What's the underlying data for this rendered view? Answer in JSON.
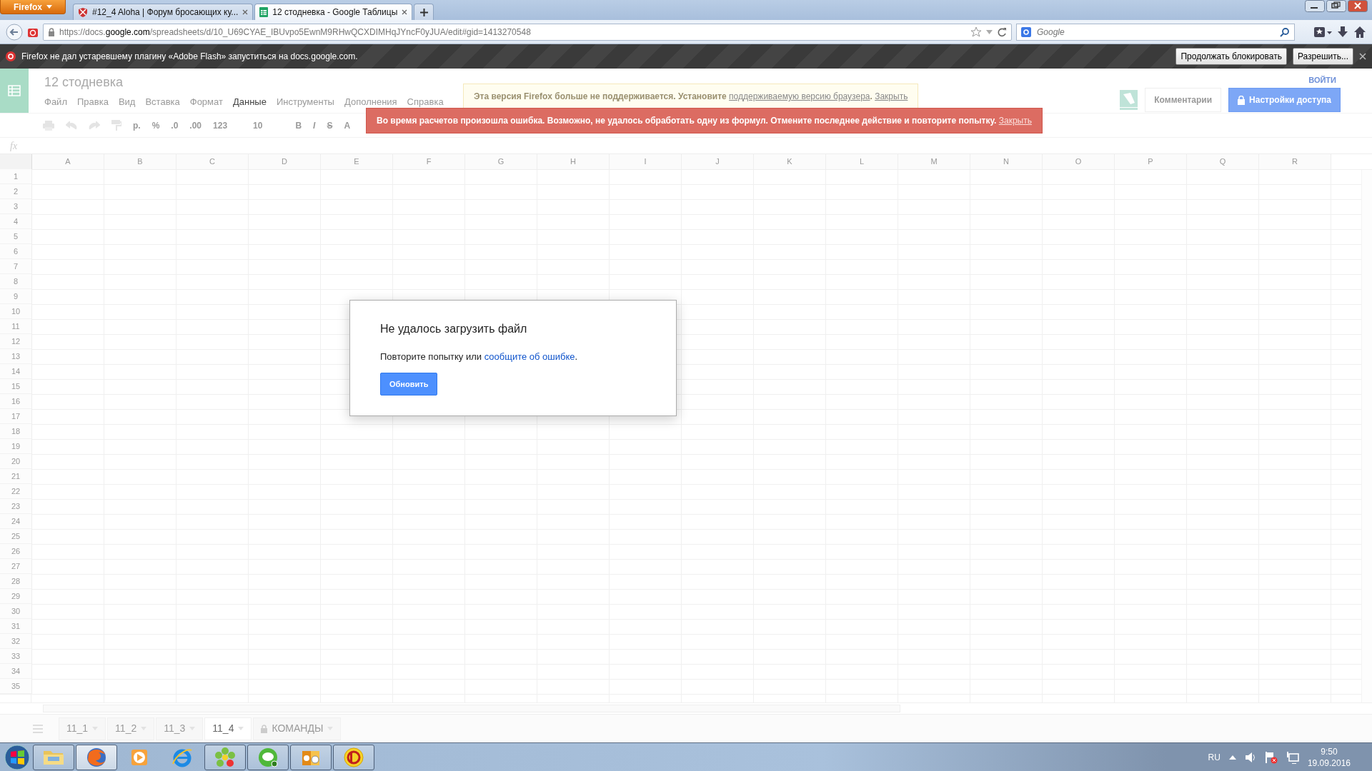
{
  "browser": {
    "menu_button": "Firefox",
    "tabs": [
      {
        "title": "#12_4 Aloha | Форум бросающих ку...",
        "selected": false,
        "kind": "forum"
      },
      {
        "title": "12 стодневка - Google Таблицы",
        "selected": true,
        "kind": "sheets"
      }
    ],
    "url": {
      "prefix": "https://docs.",
      "domain": "google.com",
      "path": "/spreadsheets/d/10_U69CYAE_IBUvpo5EwnM9RHwQCXDIMHqJYncF0yJUA/edit#gid=1413270548"
    },
    "search": {
      "placeholder": "Google"
    },
    "notification": {
      "text": "Firefox не дал устаревшему плагину «Adobe Flash» запуститься на docs.google.com.",
      "buttons": [
        "Продолжать блокировать",
        "Разрешить..."
      ]
    }
  },
  "sheet": {
    "title": "12 стодневка",
    "signin": "ВОЙТИ",
    "comments_button": "Комментарии",
    "share_button": "Настройки доступа",
    "menu": [
      {
        "label": "Файл",
        "highlighted": false
      },
      {
        "label": "Правка",
        "highlighted": false
      },
      {
        "label": "Вид",
        "highlighted": false
      },
      {
        "label": "Вставка",
        "highlighted": false
      },
      {
        "label": "Формат",
        "highlighted": false
      },
      {
        "label": "Данные",
        "highlighted": true
      },
      {
        "label": "Инструменты",
        "highlighted": false
      },
      {
        "label": "Дополнения",
        "highlighted": false
      },
      {
        "label": "Справка",
        "highlighted": false
      }
    ],
    "toolbar": {
      "currency": "р.",
      "percent": "%",
      "decrease_decimals": ".0",
      "increase_decimals": ".00",
      "format": "123",
      "font_size": "10",
      "bold": "B",
      "italic": "I",
      "strike": "S",
      "text_color": "A"
    },
    "formula_label": "fx",
    "warning": {
      "text": "Эта версия Firefox больше не поддерживается. Установите",
      "link": "поддерживаемую версию браузера",
      "after_link": ".",
      "close": "Закрыть"
    },
    "error": {
      "text": "Во время расчетов произошла ошибка. Возможно, не удалось обработать одну из формул. Отмените последнее действие и повторите попытку.",
      "close": "Закрыть"
    },
    "columns": [
      "A",
      "B",
      "C",
      "D",
      "E",
      "F",
      "G",
      "H",
      "I",
      "J",
      "K",
      "L",
      "M",
      "N",
      "O",
      "P",
      "Q",
      "R"
    ],
    "rows": [
      "1",
      "2",
      "3",
      "4",
      "5",
      "6",
      "7",
      "8",
      "9",
      "10",
      "11",
      "12",
      "13",
      "14",
      "15",
      "16",
      "17",
      "18",
      "19",
      "20",
      "21",
      "22",
      "23",
      "24",
      "25",
      "26",
      "27",
      "28",
      "29",
      "30",
      "31",
      "32",
      "33",
      "34",
      "35"
    ],
    "sheet_tabs": [
      {
        "label": "11_1",
        "selected": false,
        "locked": false
      },
      {
        "label": "11_2",
        "selected": false,
        "locked": false
      },
      {
        "label": "11_3",
        "selected": false,
        "locked": false
      },
      {
        "label": "11_4",
        "selected": true,
        "locked": false
      },
      {
        "label": "КОМАНДЫ",
        "selected": false,
        "locked": true
      }
    ]
  },
  "dialog": {
    "title": "Не удалось загрузить файл",
    "text": "Повторите попытку или",
    "link": "сообщите об ошибке",
    "after_link": ".",
    "button": "Обновить"
  },
  "taskbar": {
    "apps": [
      {
        "kind": "explorer",
        "running": true,
        "selected": false
      },
      {
        "kind": "firefox",
        "running": true,
        "selected": true
      },
      {
        "kind": "media",
        "running": false,
        "selected": false
      },
      {
        "kind": "ie",
        "running": false,
        "selected": false
      },
      {
        "kind": "icq",
        "running": true,
        "selected": false
      },
      {
        "kind": "chat",
        "running": true,
        "selected": false
      },
      {
        "kind": "outlook",
        "running": true,
        "selected": false
      },
      {
        "kind": "onec",
        "running": true,
        "selected": false
      }
    ],
    "language": "RU",
    "time": "9:50",
    "date": "19.09.2016"
  }
}
